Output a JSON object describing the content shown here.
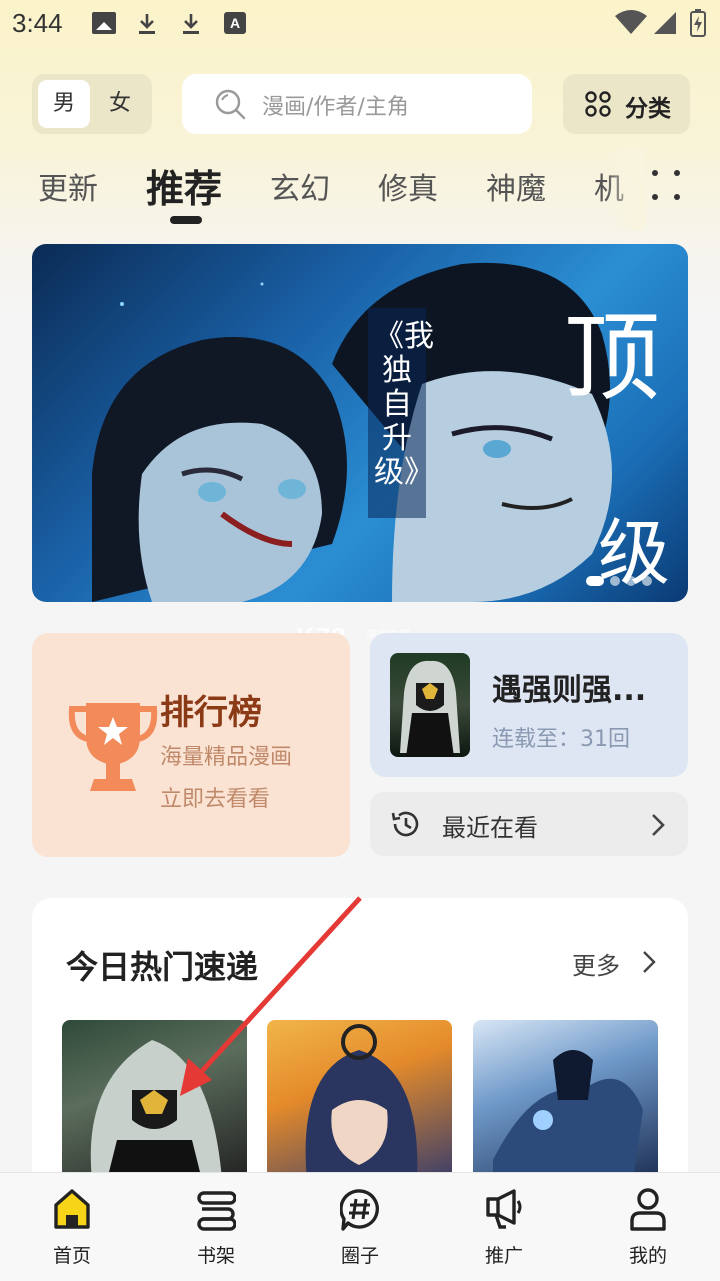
{
  "status_bar": {
    "time": "3:44",
    "icons": [
      "picture-icon",
      "download-icon",
      "download-icon",
      "a-icon",
      "wifi-icon",
      "signal-icon",
      "battery-icon"
    ],
    "a_glyph": "A"
  },
  "header": {
    "gender": {
      "male": "男",
      "female": "女",
      "selected": "男"
    },
    "search": {
      "placeholder": "漫画/作者/主角"
    },
    "category_label": "分类"
  },
  "tabs": {
    "items": [
      "更新",
      "推荐",
      "玄幻",
      "修真",
      "神魔",
      "机"
    ],
    "active": "推荐"
  },
  "banner": {
    "title": "《我独自升级》",
    "big_text_1": "顶",
    "big_text_2": "级",
    "slide_count": 4,
    "active_slide": 0,
    "colors": {
      "primary": "#1a62a8",
      "dark": "#0b2b55"
    }
  },
  "ranking": {
    "title": "排行榜",
    "subtitle_1": "海量精品漫画",
    "subtitle_2": "立即去看看",
    "accent": "#f28a5a"
  },
  "continue_reading": {
    "title": "遇强则强...",
    "subtitle": "连载至：31回"
  },
  "recent": {
    "label": "最近在看"
  },
  "hot": {
    "title": "今日热门速递",
    "more_label": "更多"
  },
  "watermark": {
    "brand": "K73",
    "sub": "游戏之家"
  },
  "bottom_nav": {
    "items": [
      {
        "label": "首页",
        "icon": "home-icon"
      },
      {
        "label": "书架",
        "icon": "bookshelf-icon"
      },
      {
        "label": "圈子",
        "icon": "hashtag-icon"
      },
      {
        "label": "推广",
        "icon": "megaphone-icon"
      },
      {
        "label": "我的",
        "icon": "profile-icon"
      }
    ],
    "active": "首页",
    "active_color": "#f7d417"
  }
}
